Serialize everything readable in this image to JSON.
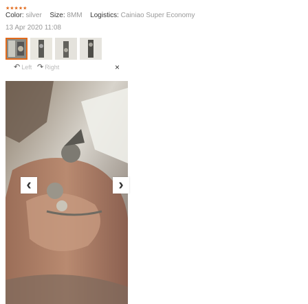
{
  "review": {
    "stars": "★★★★★",
    "color_label": "Color:",
    "color_value": "silver",
    "size_label": "Size:",
    "size_value": "8MM",
    "logistics_label": "Logistics:",
    "logistics_value": "Cainiao Super Economy",
    "date": "13 Apr 2020 11:08"
  },
  "viewer": {
    "rotate_left_label": "Left",
    "rotate_right_label": "Right",
    "rotate_left_icon": "↶",
    "rotate_right_icon": "↷",
    "close_icon": "×",
    "prev_icon": "‹",
    "next_icon": "›",
    "thumbnail_count": 4,
    "active_thumbnail": 1
  },
  "colors": {
    "star": "#e26a1b",
    "active_outline": "#e26a1b",
    "muted_text": "#999999"
  }
}
